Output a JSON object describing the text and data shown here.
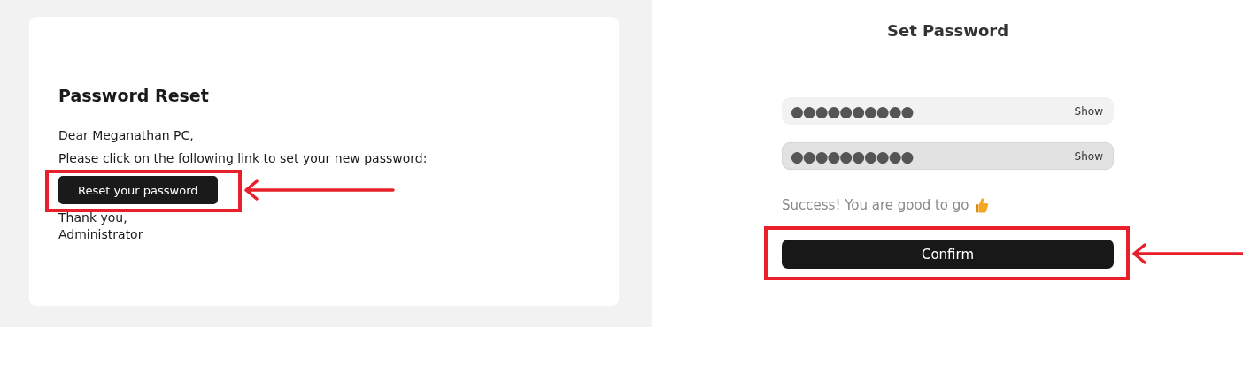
{
  "email": {
    "title": "Password Reset",
    "greeting": "Dear Meganathan PC,",
    "instruction": "Please click on the following link to set your new password:",
    "button": {
      "label": "Reset your password",
      "highlighted": true
    },
    "closing": [
      "Thank you,",
      "Administrator"
    ]
  },
  "set_password": {
    "title": "Set Password",
    "fields": [
      {
        "value": "●●●●●●●●●●",
        "toggle": "Show",
        "focused": false
      },
      {
        "value": "●●●●●●●●●●",
        "toggle": "Show",
        "focused": true
      }
    ],
    "message": "Success! You are good to go",
    "button": {
      "label": "Confirm",
      "highlighted": true
    }
  }
}
